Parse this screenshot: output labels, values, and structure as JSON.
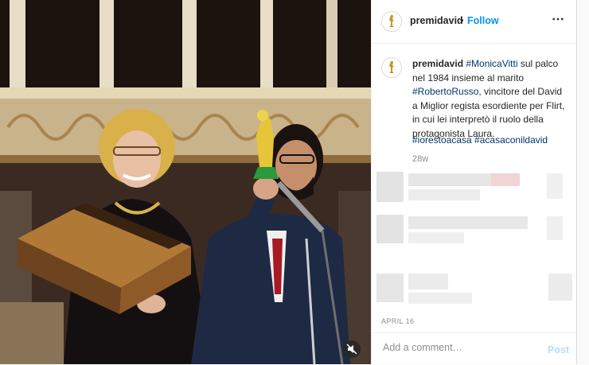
{
  "post": {
    "username": "premidavid",
    "separator": "•",
    "follow_label": "Follow",
    "more_icon": "⋯",
    "caption_user": "premidavid",
    "caption_parts": [
      {
        "text": "#MonicaVitti",
        "tag": true
      },
      {
        "text": " sul palco nel 1984 insieme al marito ",
        "tag": false
      },
      {
        "text": "#RobertoRusso",
        "tag": true
      },
      {
        "text": ", vincitore del David a Miglior regista esordiente per Flirt, in cui lei interpretò il ruolo della protagonista Laura.",
        "tag": false
      }
    ],
    "hashtags": "#iorestoacasa #acasaconildavid",
    "age": "28w",
    "date": "APRIL 16",
    "comment_placeholder": "Add a comment…",
    "post_label": "Post"
  },
  "media": {
    "type": "video",
    "mute_icon": "speaker-muted-icon"
  },
  "colors": {
    "link": "#0095f6",
    "hashtag": "#00376b",
    "muted": "#8e8e8e"
  }
}
